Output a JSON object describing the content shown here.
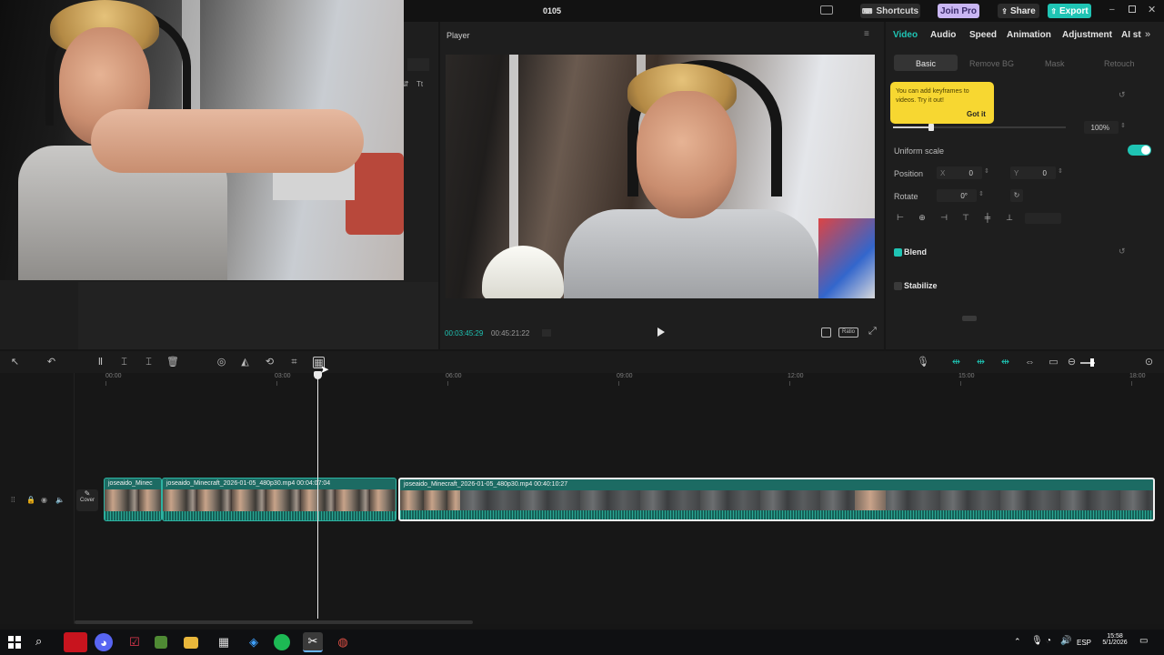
{
  "app": {
    "title": "0105"
  },
  "topbar": {
    "shortcuts_label": "Shortcuts",
    "join_pro_label": "Join Pro",
    "share_label": "Share",
    "export_label": "Export"
  },
  "player": {
    "title": "Player",
    "current_time": "00:03:45:29",
    "total_time": "00:45:21:22",
    "ratio_label": "Ratio"
  },
  "inspector": {
    "tabs": [
      "Video",
      "Audio",
      "Speed",
      "Animation",
      "Adjustment",
      "AI st"
    ],
    "subtabs": [
      "Basic",
      "Remove BG",
      "Mask",
      "Retouch"
    ],
    "tooltip": {
      "text": "You can add keyframes to videos. Try it out!",
      "button": "Got it"
    },
    "scale_value": "100%",
    "uniform_scale_label": "Uniform scale",
    "position_label": "Position",
    "position_x_axis": "X",
    "position_x": "0",
    "position_y_axis": "Y",
    "position_y": "0",
    "rotate_label": "Rotate",
    "rotate_value": "0°",
    "blend_label": "Blend",
    "stabilize_label": "Stabilize"
  },
  "timeline": {
    "ruler": [
      "00:00",
      "03:00",
      "06:00",
      "09:00",
      "12:00",
      "15:00",
      "18:00"
    ],
    "cover_label": "Cover",
    "clips": [
      {
        "title": "joseaido_Minec"
      },
      {
        "title": "joseaido_Minecraft_2026-01-05_480p30.mp4  00:04:07:04"
      },
      {
        "title": "joseaido_Minecraft_2026-01-05_480p30.mp4  00:40:10:27"
      }
    ]
  },
  "taskbar": {
    "language": "ESP",
    "time": "15:58",
    "date": "5/1/2026"
  },
  "colors": {
    "accent": "#1fc4b4",
    "tooltip": "#f7d731",
    "clip": "#1c6b63",
    "join_pro": "#c9b6f3"
  }
}
